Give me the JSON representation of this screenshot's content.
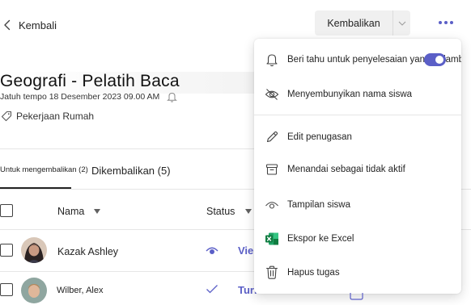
{
  "header": {
    "back_label": "Kembali",
    "return_button_label": "Kembalikan"
  },
  "assignment": {
    "title": "Geografi - Pelatih Baca",
    "due": "Jatuh tempo 18 Desember 2023 09.00 AM",
    "category": "Pekerjaan Rumah"
  },
  "tabs": [
    {
      "label": "Untuk mengembalikan (2)",
      "selected": true
    },
    {
      "label": "Dikembalikan (5)",
      "selected": false
    }
  ],
  "table": {
    "columns": [
      "Nama",
      "Status"
    ],
    "rows": [
      {
        "name": "Kazak Ashley",
        "status": "Vie",
        "status_icon": "eye-icon"
      },
      {
        "name": "Wilber, Alex",
        "status": "Turned in",
        "status_icon": "checkmark-icon"
      }
    ]
  },
  "menu": {
    "items": [
      {
        "label": "Beri tahu untuk penyelesaian yang terlambat",
        "icon": "bell-icon",
        "toggle_on": true
      },
      {
        "label": "Menyembunyikan nama siswa",
        "icon": "eye-off-icon"
      },
      {
        "label": "Edit penugasan",
        "icon": "pencil-icon"
      },
      {
        "label": "Menandai sebagai tidak aktif",
        "icon": "archive-icon"
      },
      {
        "label": "Tampilan siswa",
        "icon": "eye-icon"
      },
      {
        "label": "Ekspor ke Excel",
        "icon": "excel-icon"
      },
      {
        "label": "Hapus tugas",
        "icon": "trash-icon"
      }
    ]
  },
  "colors": {
    "accent": "#5b5fc7",
    "excel_green": "#107c41"
  }
}
